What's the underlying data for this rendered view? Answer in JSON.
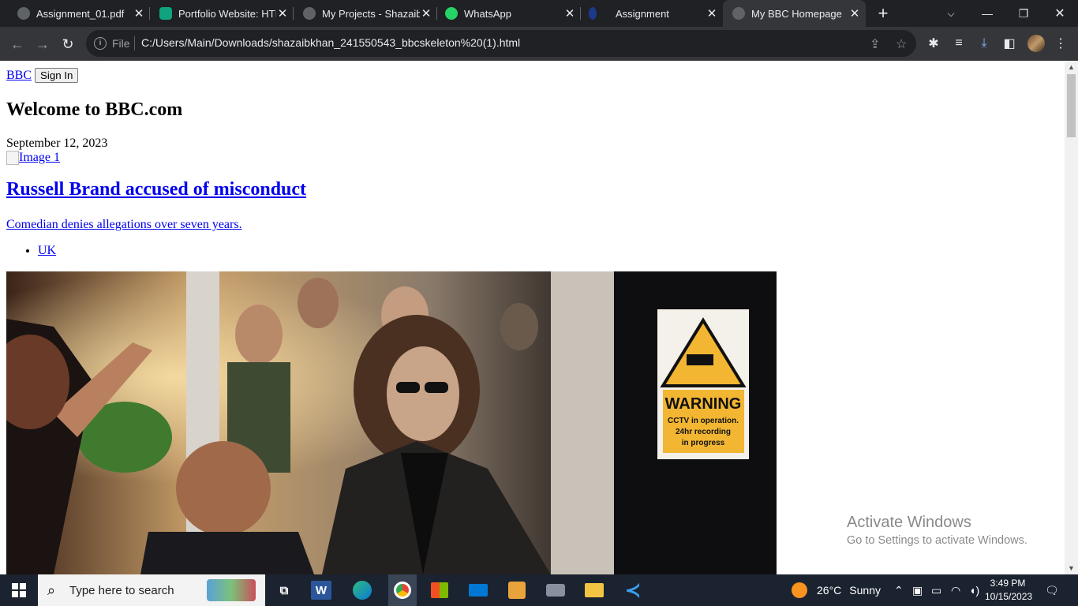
{
  "browser": {
    "tabs": [
      {
        "title": "Assignment_01.pdf",
        "favicon": "globe-icon"
      },
      {
        "title": "Portfolio Website: HTI",
        "favicon": "chatgpt-icon"
      },
      {
        "title": "My Projects - Shazaib",
        "favicon": "globe-icon"
      },
      {
        "title": "WhatsApp",
        "favicon": "whatsapp-icon"
      },
      {
        "title": "Assignment",
        "favicon": "assignment-icon"
      },
      {
        "title": "My BBC Homepage",
        "favicon": "globe-icon",
        "active": true
      }
    ],
    "new_tab": "+",
    "address": {
      "scheme_label": "File",
      "url": "C:/Users/Main/Downloads/shazaibkhan_241550543_bbcskeleton%20(1).html"
    }
  },
  "page": {
    "brand_link": "BBC",
    "sign_in": "Sign In",
    "heading": "Welcome to BBC.com",
    "date": "September 12, 2023",
    "image_alt": "Image 1",
    "headline": "Russell Brand accused of misconduct",
    "summary": "Comedian denies allegations over seven years.",
    "nav_items": [
      "UK"
    ],
    "photo_sign": {
      "title": "WARNING",
      "line1": "CCTV in operation.",
      "line2": "24hr recording",
      "line3": "in progress"
    }
  },
  "watermark": {
    "line1": "Activate Windows",
    "line2": "Go to Settings to activate Windows."
  },
  "taskbar": {
    "search_placeholder": "Type here to search",
    "weather_temp": "26°C",
    "weather_cond": "Sunny",
    "time": "3:49 PM",
    "date": "10/15/2023"
  },
  "colors": {
    "tabstrip": "#202124",
    "toolbar": "#35363a",
    "link": "#0000ee",
    "taskbar": "#1b2330",
    "warning_yellow": "#f2b632"
  }
}
